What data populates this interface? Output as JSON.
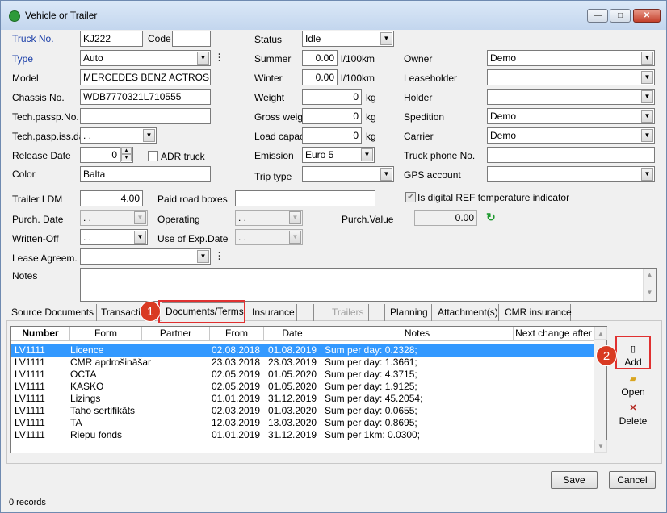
{
  "window": {
    "title": "Vehicle or Trailer",
    "min": "—",
    "max": "□",
    "close": "✕"
  },
  "left": {
    "truck_no_label": "Truck No.",
    "truck_no": "KJ222",
    "code_label": "Code",
    "code": "",
    "type_label": "Type",
    "type": "Auto",
    "model_label": "Model",
    "model": "MERCEDES BENZ ACTROS 18",
    "chassis_label": "Chassis No.",
    "chassis": "WDB7770321L710555",
    "techpass_label": "Tech.passp.No.",
    "techpass": "",
    "techiss_label": "Tech.pasp.iss.dat",
    "techiss": ". .",
    "release_label": "Release Date",
    "release": "0",
    "adr_label": "ADR truck",
    "color_label": "Color",
    "color": "Balta"
  },
  "middle": {
    "status_label": "Status",
    "status": "Idle",
    "summer_label": "Summer",
    "summer": "0.00",
    "summer_unit": "l/100km",
    "winter_label": "Winter",
    "winter": "0.00",
    "winter_unit": "l/100km",
    "weight_label": "Weight",
    "weight": "0",
    "weight_unit": "kg",
    "gross_label": "Gross weight",
    "gross": "0",
    "gross_unit": "kg",
    "load_label": "Load capacity",
    "load": "0",
    "load_unit": "kg",
    "emission_label": "Emission",
    "emission": "Euro 5",
    "trip_label": "Trip type",
    "trip": ""
  },
  "right": {
    "owner_label": "Owner",
    "owner": "Demo",
    "leaseholder_label": "Leaseholder",
    "leaseholder": "",
    "holder_label": "Holder",
    "holder": "",
    "spedition_label": "Spedition",
    "spedition": "Demo",
    "carrier_label": "Carrier",
    "carrier": "Demo",
    "phone_label": "Truck phone No.",
    "phone": "",
    "gps_label": "GPS account",
    "gps": ""
  },
  "lower": {
    "trailer_ldm_label": "Trailer LDM",
    "trailer_ldm": "4.00",
    "paid_road_label": "Paid road boxes",
    "paid_road": "",
    "ref_label": "Is digital REF temperature indicator",
    "purch_date_label": "Purch. Date",
    "purch_date": ". .",
    "operating_label": "Operating",
    "operating": ". .",
    "purch_value_label": "Purch.Value",
    "purch_value": "0.00",
    "written_label": "Written-Off",
    "written": ". .",
    "exp_label": "Use of Exp.Date",
    "exp": ". .",
    "lease_label": "Lease Agreem.",
    "lease": "",
    "notes_label": "Notes",
    "notes": ""
  },
  "tabs": [
    {
      "label": "Source Documents"
    },
    {
      "label": "Transacti"
    },
    {
      "label": "Documents/Terms"
    },
    {
      "label": "Insurance"
    },
    {
      "label": ""
    },
    {
      "label": "Trailers"
    },
    {
      "label": ""
    },
    {
      "label": "Planning"
    },
    {
      "label": "Attachment(s)"
    },
    {
      "label": "CMR insurance"
    }
  ],
  "badges": {
    "one": "1",
    "two": "2"
  },
  "grid": {
    "columns": [
      "Number",
      "Form",
      "Partner",
      "From",
      "Date",
      "Notes",
      "Next change after"
    ],
    "rows": [
      {
        "number": "LV1111",
        "form": "Licence",
        "partner": "",
        "from": "02.08.2018",
        "date": "01.08.2019",
        "notes": "Sum per day: 0.2328;"
      },
      {
        "number": "LV1111",
        "form": "CMR apdrošināšar",
        "partner": "",
        "from": "23.03.2018",
        "date": "23.03.2019",
        "notes": "Sum per day: 1.3661;"
      },
      {
        "number": "LV1111",
        "form": "OCTA",
        "partner": "",
        "from": "02.05.2019",
        "date": "01.05.2020",
        "notes": "Sum per day: 4.3715;"
      },
      {
        "number": "LV1111",
        "form": "KASKO",
        "partner": "",
        "from": "02.05.2019",
        "date": "01.05.2020",
        "notes": "Sum per day: 1.9125;"
      },
      {
        "number": "LV1111",
        "form": "Lizings",
        "partner": "",
        "from": "01.01.2019",
        "date": "31.12.2019",
        "notes": "Sum per day: 45.2054;"
      },
      {
        "number": "LV1111",
        "form": "Taho sertifikāts",
        "partner": "",
        "from": "02.03.2019",
        "date": "01.03.2020",
        "notes": "Sum per day: 0.0655;"
      },
      {
        "number": "LV1111",
        "form": "TA",
        "partner": "",
        "from": "12.03.2019",
        "date": "13.03.2020",
        "notes": "Sum per day: 0.8695;"
      },
      {
        "number": "LV1111",
        "form": "Riepu fonds",
        "partner": "",
        "from": "01.01.2019",
        "date": "31.12.2019",
        "notes": "Sum per 1km: 0.0300;"
      }
    ]
  },
  "side": {
    "add": "Add",
    "open": "Open",
    "delete": "Delete"
  },
  "buttons": {
    "save": "Save",
    "cancel": "Cancel"
  },
  "status": {
    "records": "0 records"
  }
}
